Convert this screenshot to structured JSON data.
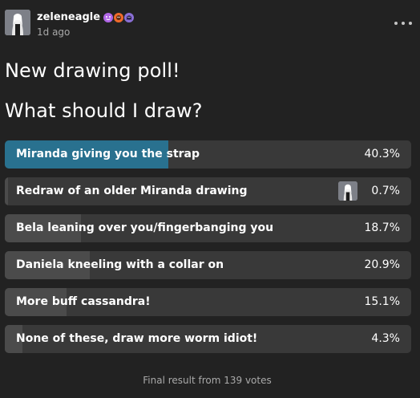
{
  "post": {
    "username": "zeleneagle",
    "timestamp": "1d ago",
    "avatar_icon": "avatar-pale-figure",
    "badges": [
      {
        "icon": "purple-smiley-badge-icon",
        "color": "#b066e6"
      },
      {
        "icon": "orange-face-badge-icon",
        "color": "#f06a2a"
      },
      {
        "icon": "purple-ghost-badge-icon",
        "color": "#8a6fd6"
      }
    ],
    "more_icon": "more-horizontal-icon",
    "title": "New drawing poll!",
    "question": "What should I draw?"
  },
  "poll": {
    "options": [
      {
        "label": "Miranda giving you the strap",
        "percent_text": "40.3%",
        "percent": 40.3,
        "winner": true
      },
      {
        "label": "Redraw of an older Miranda drawing",
        "percent_text": "0.7%",
        "percent": 0.7,
        "voted": true
      },
      {
        "label": "Bela leaning over you/fingerbanging you",
        "percent_text": "18.7%",
        "percent": 18.7
      },
      {
        "label": "Daniela kneeling with a collar on",
        "percent_text": "20.9%",
        "percent": 20.9
      },
      {
        "label": "More buff cassandra!",
        "percent_text": "15.1%",
        "percent": 15.1
      },
      {
        "label": "None of these, draw more worm idiot!",
        "percent_text": "4.3%",
        "percent": 4.3
      }
    ],
    "footer": "Final result from 139 votes"
  },
  "colors": {
    "background": "#222222",
    "bar": "#393939",
    "bar_fill": "#4b4b4b",
    "winner_fill": "#29718f"
  }
}
